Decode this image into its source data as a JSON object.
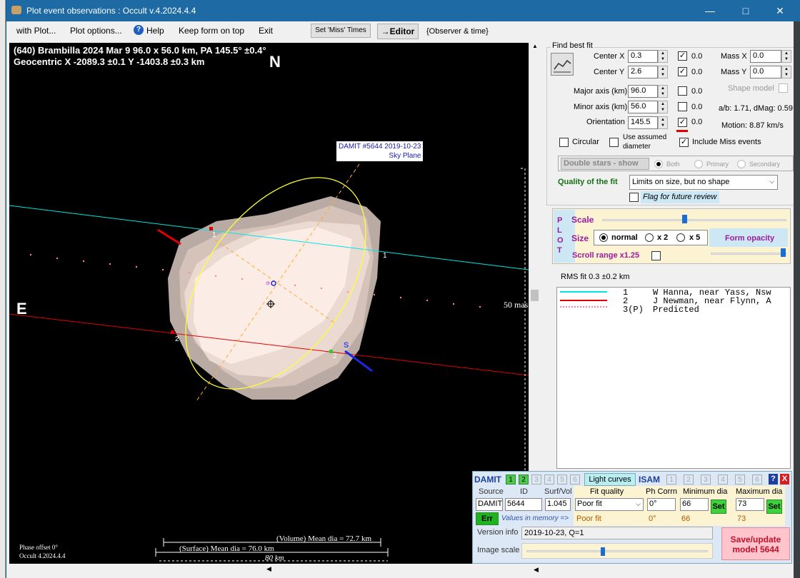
{
  "window": {
    "title": "Plot event observations : Occult v.4.2024.4.4"
  },
  "menu": {
    "items": [
      "with Plot...",
      "Plot options...",
      "Help",
      "Keep form on top",
      "Exit"
    ],
    "set_miss_times": "Set 'Miss' Times",
    "editor": "→Editor",
    "observer_time": "{Observer & time}"
  },
  "plot": {
    "header_line1": "(640) Brambilla  2024 Mar 9   96.0 x 56.0 km,  PA 145.5° ±0.4°",
    "header_line2": "Geocentric  X  -2089.3 ±0.1  Y -1403.8 ±0.3 km",
    "north": "N",
    "east": "E",
    "damit_label1": "DAMIT #5644 2019-10-23",
    "damit_label2": "Sky Plane",
    "scale_label": "50 mas",
    "chord_labels": [
      "1",
      "2",
      "1",
      "2",
      "2"
    ],
    "s_label": "S",
    "phase_offset": "Phase offset 0°",
    "version": "Occult 4.2024.4.4",
    "volume_dia": "(Volume) Mean dia = 72.7 km",
    "surface_dia": "(Surface) Mean dia = 76.0 km",
    "scale_km": "80 km"
  },
  "fit": {
    "group_title": "Find best fit",
    "center_x_label": "Center X",
    "center_x": "0.3",
    "center_y_label": "Center Y",
    "center_y": "2.6",
    "major_label": "Major axis (km)",
    "major": "96.0",
    "minor_label": "Minor axis (km)",
    "minor": "56.0",
    "orient_label": "Orientation",
    "orient": "145.5",
    "d0": "0.0",
    "d1": "0.0",
    "d2": "0.0",
    "d3": "0.0",
    "d4": "0.0",
    "mass_x_label": "Mass X",
    "mass_x": "0.0",
    "mass_y_label": "Mass Y",
    "mass_y": "0.0",
    "shape_model_label": "Shape model",
    "ab": "a/b: 1.71, dMag: 0.59",
    "motion": "Motion: 8.87 km/s",
    "circular": "Circular",
    "use_assumed1": "Use assumed",
    "use_assumed2": "diameter",
    "include_miss": "Include Miss events"
  },
  "double": {
    "label": "Double stars - show",
    "both": "Both",
    "primary": "Primary",
    "secondary": "Secondary"
  },
  "quality": {
    "label": "Quality of the fit",
    "value": "Limits on size, but no shape",
    "flag": "Flag for future review"
  },
  "plotpanel": {
    "plot_letters": [
      "P",
      "L",
      "O",
      "T"
    ],
    "scale": "Scale",
    "size": "Size",
    "normal": "normal",
    "x2": "x 2",
    "x5": "x 5",
    "form_opacity": "Form opacity",
    "scroll_range": "Scroll range x1.25"
  },
  "rms": "RMS fit 0.3 ±0.2 km",
  "legend": [
    {
      "num": "1",
      "name": "W Hanna, near Yass, Nsw",
      "color": "#00e5e5"
    },
    {
      "num": "2",
      "name": "J Newman, near Flynn, A",
      "color": "#e00000"
    },
    {
      "num": "3(P)",
      "name": "Predicted",
      "color": "#ff7f9f"
    }
  ],
  "damit": {
    "title": "DAMIT",
    "nums": [
      "1",
      "2",
      "3",
      "4",
      "5",
      "6"
    ],
    "light_curves": "Light curves",
    "isam": "ISAM",
    "isam_nums": [
      "1",
      "2",
      "3",
      "4",
      "5",
      "6"
    ],
    "help": "?",
    "close": "X",
    "source_label": "Source",
    "id_label": "ID",
    "surf_label": "Surf/Vol",
    "fit_quality_label": "Fit quality",
    "ph_corr_label": "Ph Corrn",
    "min_dia_label": "Minimum dia",
    "max_dia_label": "Maximum dia",
    "source": "DAMIT",
    "id": "5644",
    "surf": "1.045",
    "fit_quality": "Poor fit",
    "ph_corr": "0°",
    "min_dia": "66",
    "max_dia": "73",
    "set": "Set",
    "err": "Err",
    "values_in_memory": "Values in memory =>",
    "mem_fit": "Poor fit",
    "mem_ph": "0°",
    "mem_min": "66",
    "mem_max": "73",
    "version_label": "Version info",
    "version": "2019-10-23, Q=1",
    "image_scale_label": "Image scale",
    "save": "Save/update model 5644"
  }
}
